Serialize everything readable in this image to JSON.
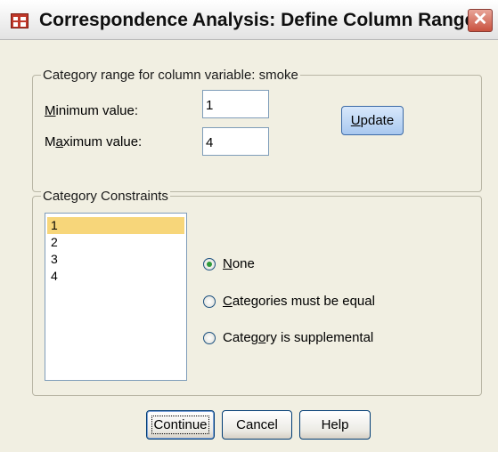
{
  "window": {
    "title": "Correspondence Analysis: Define Column Range",
    "close_glyph": "✕"
  },
  "range_group": {
    "legend": "Category range for column variable: smoke",
    "min_label_accel": "M",
    "min_label_rest": "inimum value:",
    "min_value": "1",
    "max_label_pre": "M",
    "max_label_accel": "a",
    "max_label_rest": "ximum value:",
    "max_value": "4",
    "update_accel": "U",
    "update_rest": "pdate"
  },
  "constraints_group": {
    "legend": "Category Constraints",
    "categories": [
      "1",
      "2",
      "3",
      "4"
    ],
    "selected_index": 0,
    "options": [
      {
        "accel": "N",
        "rest": "one",
        "checked": true
      },
      {
        "accel": "C",
        "rest": "ategories must be equal",
        "checked": false
      },
      {
        "pre": "Categ",
        "accel": "o",
        "rest": "ry is supplemental",
        "checked": false
      }
    ]
  },
  "footer": {
    "continue_label": "Continue",
    "cancel_label": "Cancel",
    "help_label": "Help"
  },
  "colors": {
    "dialog_bg": "#f1efe2",
    "selection": "#f7d67a",
    "close_button": "#c9523f",
    "radio_dot": "#2e9a3a"
  }
}
